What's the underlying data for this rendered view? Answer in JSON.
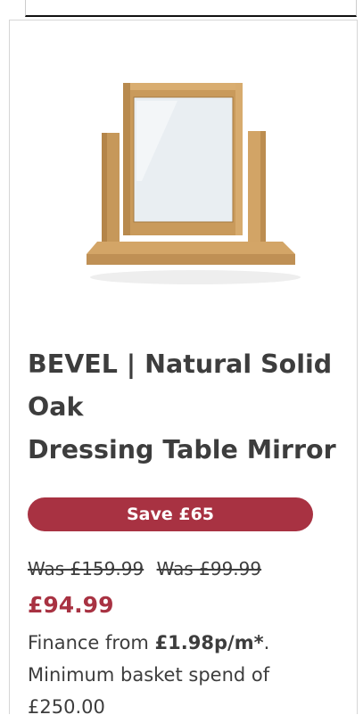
{
  "product": {
    "image_alt": "Bevel natural solid oak dressing table mirror",
    "title_line1": "BEVEL | Natural Solid",
    "title_line2": "Oak",
    "title_line3": "Dressing Table Mirror",
    "save_label": "Save £65",
    "was_price_1": "Was £159.99",
    "was_price_2": "Was £99.99",
    "price": "£94.99",
    "finance_prefix": "Finance from ",
    "finance_amount": "£1.98p/m*",
    "finance_suffix": ".",
    "finance_note": "Minimum basket spend of £250.00"
  },
  "colors": {
    "accent": "#a83242",
    "oak": "#c99a5b",
    "text": "#3d3d3d"
  }
}
